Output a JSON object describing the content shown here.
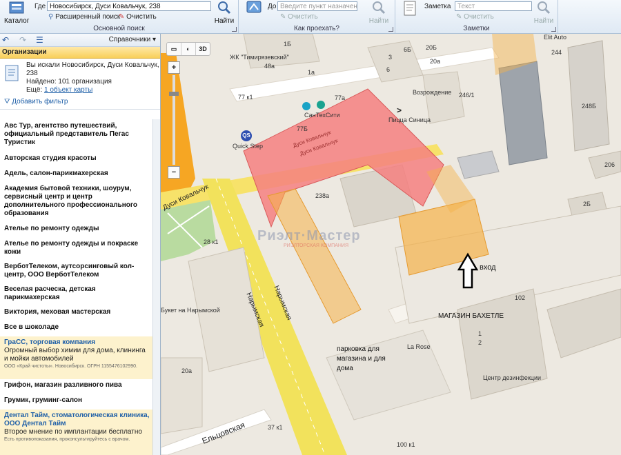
{
  "ribbon": {
    "catalog_label": "Каталог",
    "where_label": "Где",
    "where_value": "Новосибирск, Дуси Ковальчук, 238",
    "find_label": "Найти",
    "advanced_search": "Расширенный поиск",
    "clear": "Очистить",
    "group_main": "Основной поиск",
    "to_label": "До",
    "to_placeholder": "Введите пункт назначения",
    "clear2": "Очистить",
    "find2": "Найти",
    "group_route": "Как проехать?",
    "note_label": "Заметка",
    "note_placeholder": "Текст",
    "clear3": "Очистить",
    "find3": "Найти",
    "group_notes": "Заметки"
  },
  "panel": {
    "references_label": "Справочники",
    "section_title": "Организации",
    "summary_line1": "Вы искали Новосибирск, Дуси Ковальчук,",
    "summary_line2": "238",
    "summary_found": "Найдено: 101 организация",
    "summary_more_prefix": "Ещё:",
    "summary_more_link": "1 объект карты",
    "add_filter": "Добавить фильтр",
    "orgs": [
      {
        "title": "Авс Тур, агентство путешествий, официальный представитель Пегас Туристик"
      },
      {
        "title": "Авторская студия красоты"
      },
      {
        "title": "Адель, салон-парикмахерская"
      },
      {
        "title": "Академия бытовой техники, шоурум, сервисный центр и центр дополнительного профессионального образования"
      },
      {
        "title": "Ателье по ремонту одежды"
      },
      {
        "title": "Ателье по ремонту одежды и покраске кожи"
      },
      {
        "title": "ВерботТелеком, аутсорсинговый кол-центр, ООО ВерботТелеком"
      },
      {
        "title": "Веселая расческа, детская парикмахерская"
      },
      {
        "title": "Виктория, меховая мастерская"
      },
      {
        "title": "Все в шоколаде"
      }
    ],
    "ad1": {
      "title": "ГраСС, торговая компания",
      "desc": "Огромный выбор химии для дома, клининга и мойки автомобилей",
      "small": "ООО «Край чистоты». Новосибирск. ОГРН 1155476102990."
    },
    "orgs2": [
      {
        "title": "Грифон, магазин разливного пива"
      },
      {
        "title": "Грумик, груминг-салон"
      }
    ],
    "ad2": {
      "title": "Дентал Тайм, стоматологическая клиника, ООО Дентал Тайм",
      "desc": "Второе мнение по имплантации бесплатно",
      "small": "Есть противопоказания, проконсультируйтесь с врачом."
    }
  },
  "map": {
    "mode_3d": "3D",
    "labels": {
      "zhk": "ЖК \"Тимирязевский\"",
      "n1b": "1Б",
      "n6b": "6Б",
      "n20b": "20Б",
      "n3": "3",
      "n48a": "48а",
      "n1a": "1а",
      "n6": "6",
      "n20a": "20а",
      "n77k1": "77 к1",
      "n77a": "77а",
      "n77b": "77Б",
      "n246k1": "246/1",
      "n244": "244",
      "n248b": "248Б",
      "n206": "206",
      "n238a": "238а",
      "n2b": "2Б",
      "n28k1": "28 к1",
      "n102": "102",
      "n1": "1",
      "n2": "2",
      "n20a2": "20а",
      "n37k1": "37 к1",
      "n100k1": "100 к1",
      "santeh": "СанТехСити",
      "pizza": "Пицца Синица",
      "vozr": "Возрождение",
      "quickstep": "Quick Step",
      "elitauto": "Elit Auto",
      "buket": "Букет на Нарымской",
      "larose": "La Rose",
      "dezinf": "Центр дезинфекции",
      "bakhetle": "МАГАЗИН БАХЕТЛЕ",
      "vkhod": "вход",
      "parking": "парковка для магазина и для дома",
      "parking1": "парковка для",
      "parking2": "магазина и для",
      "parking3": "дома",
      "bldg_sign1": "Дуси Ковальчук",
      "bldg_sign2": "Дуси Ковальчук"
    },
    "streets": {
      "kovalchuk": "Дуси Ковальчук",
      "narymskaya1": "Нарымская",
      "narymskaya2": "Нарымская",
      "eltsovskaya": "Ельцовская"
    },
    "watermark": "Риэлт·Мастер",
    "watermark_sub": "РИЭЛТОРСКАЯ КОМПАНИЯ",
    "colors": {
      "highlight": "#f48080",
      "highlight_3d": "#f5b24a",
      "road_major": "#f2e25c",
      "road_orange": "#f6a623",
      "park": "#b9dba0"
    }
  }
}
